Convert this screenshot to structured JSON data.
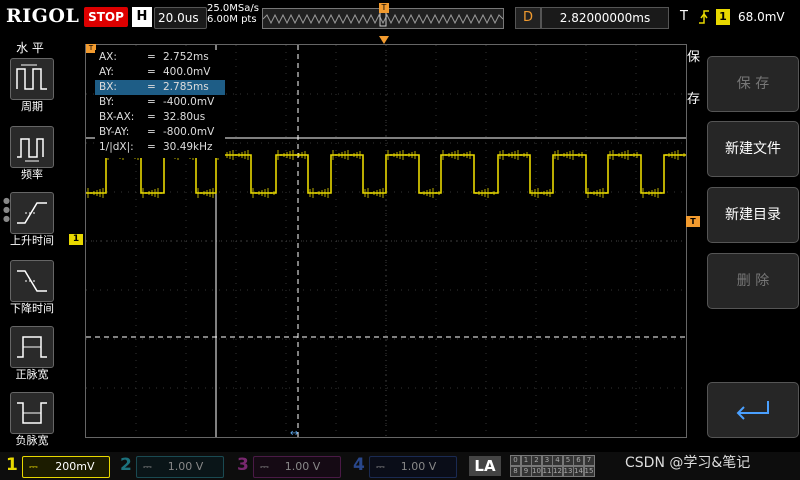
{
  "header": {
    "brand": "RIGOL",
    "run_state": "STOP",
    "timebase_label": "H",
    "timebase_value": "20.0us",
    "sample_rate": "25.0MSa/s",
    "memory_depth": "6.00M pts",
    "trigger_pos_marker": "T",
    "delay_label": "D",
    "delay_value": "2.82000000ms",
    "trigger_label": "T",
    "trigger_channel": "1",
    "trigger_level": "68.0mV"
  },
  "left_menu": {
    "title": "水 平",
    "items": [
      {
        "label": "周期",
        "icon": "period-icon"
      },
      {
        "label": "频率",
        "icon": "frequency-icon"
      },
      {
        "label": "上升时间",
        "icon": "rise-time-icon"
      },
      {
        "label": "下降时间",
        "icon": "fall-time-icon"
      },
      {
        "label": "正脉宽",
        "icon": "positive-width-icon"
      },
      {
        "label": "负脉宽",
        "icon": "negative-width-icon"
      }
    ]
  },
  "cursor_readout": {
    "rows": [
      {
        "name": "AX:",
        "eq": "=",
        "value": "2.752ms"
      },
      {
        "name": "AY:",
        "eq": "=",
        "value": "400.0mV"
      },
      {
        "name": "BX:",
        "eq": "=",
        "value": "2.785ms"
      },
      {
        "name": "BY:",
        "eq": "=",
        "value": "-400.0mV"
      },
      {
        "name": "BX-AX:",
        "eq": "=",
        "value": "32.80us"
      },
      {
        "name": "BY-AY:",
        "eq": "=",
        "value": "-800.0mV"
      },
      {
        "name": "1/|dX|:",
        "eq": "=",
        "value": "30.49kHz"
      }
    ],
    "selected_row": 2
  },
  "markers": {
    "ch1": "1",
    "trigger_top": "T",
    "trigger_level_right": "T"
  },
  "right_menu": {
    "side_title_1": "保",
    "side_title_2": "存",
    "buttons": [
      {
        "label": "保 存",
        "enabled": false
      },
      {
        "label": "新建文件",
        "enabled": true
      },
      {
        "label": "新建目录",
        "enabled": true
      },
      {
        "label": "删 除",
        "enabled": false
      },
      {
        "label": "",
        "icon": "return-arrow-icon",
        "enabled": true
      }
    ]
  },
  "channels": [
    {
      "num": "1",
      "scale": "200mV",
      "color": "#e8d800",
      "active": true
    },
    {
      "num": "2",
      "scale": "1.00 V",
      "color": "#26b5c8",
      "active": false
    },
    {
      "num": "3",
      "scale": "1.00 V",
      "color": "#c03ab0",
      "active": false
    },
    {
      "num": "4",
      "scale": "1.00 V",
      "color": "#3d6fe0",
      "active": false
    }
  ],
  "la": {
    "label": "LA",
    "row1": [
      "0",
      "1",
      "2",
      "3",
      "4",
      "5",
      "6",
      "7"
    ],
    "row2": [
      "8",
      "9",
      "10",
      "11",
      "12",
      "13",
      "14",
      "15"
    ]
  },
  "watermark": "CSDN @学习&笔记"
}
